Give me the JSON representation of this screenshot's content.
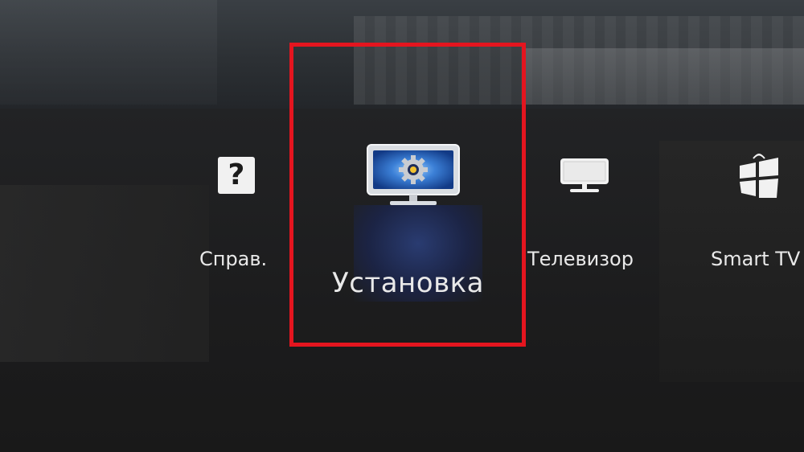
{
  "menu": {
    "items": [
      {
        "label": "Справ.",
        "icon": "help-icon"
      },
      {
        "label": "Установка",
        "icon": "setup-monitor-gear-icon",
        "selected": true
      },
      {
        "label": "Телевизор",
        "icon": "tv-icon"
      },
      {
        "label": "Smart TV",
        "icon": "smart-tv-icon"
      }
    ],
    "help_glyph": "?"
  },
  "colors": {
    "highlight_frame": "#e4151f",
    "label_text": "#e9e9e9",
    "setup_screen_blue": "#3b7fd6"
  }
}
